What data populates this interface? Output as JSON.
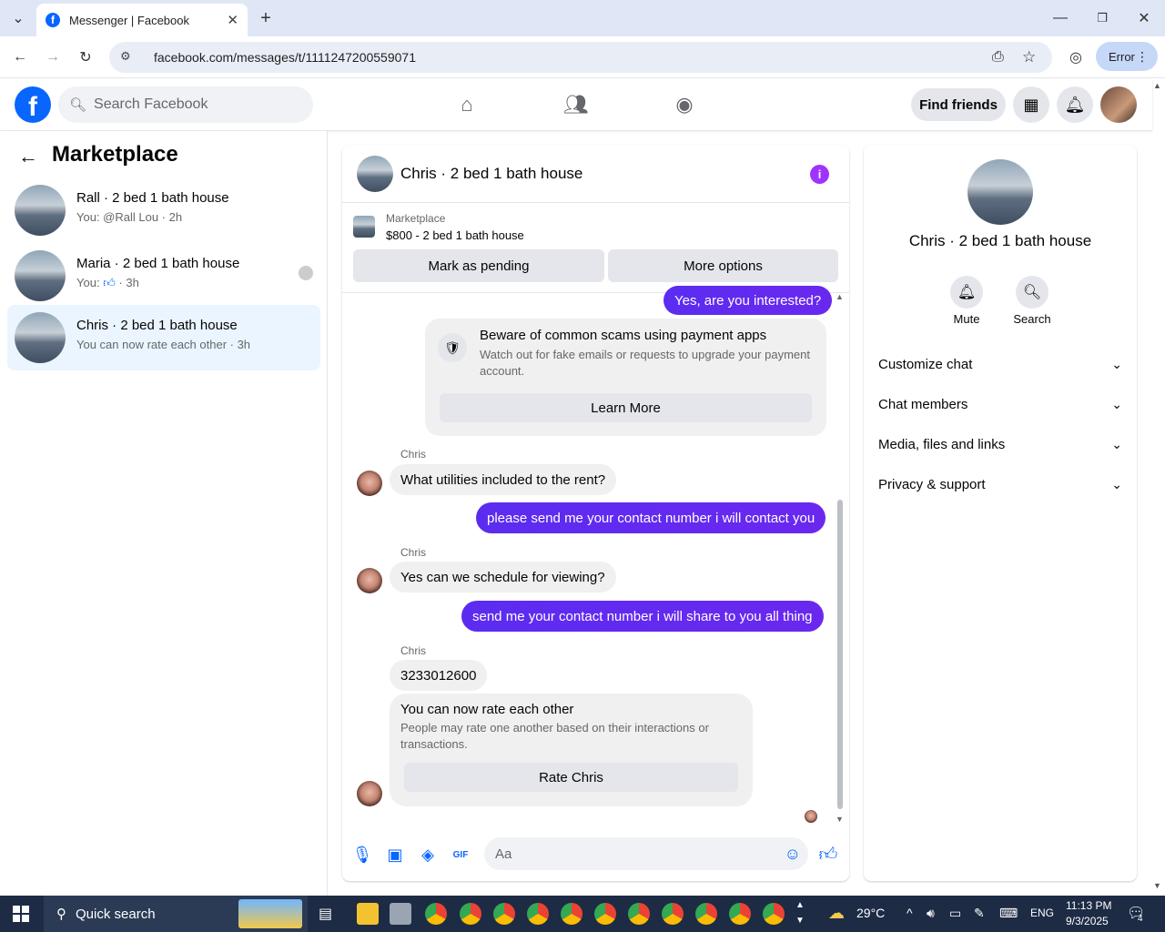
{
  "browser": {
    "tab_title": "Messenger | Facebook",
    "url": "facebook.com/messages/t/1111247200559071",
    "error_label": "Error"
  },
  "fb": {
    "search_placeholder": "Search Facebook",
    "find_friends": "Find friends"
  },
  "left": {
    "title": "Marketplace",
    "conversations": [
      {
        "title": "Rall · 2 bed 1 bath house",
        "preview": "You: @Rall Lou · 2h"
      },
      {
        "title": "Maria · 2 bed 1 bath house",
        "preview_prefix": "You:",
        "preview_suffix": "· 3h"
      },
      {
        "title": "Chris · 2 bed 1 bath house",
        "preview": "You can now rate each other · 3h"
      }
    ]
  },
  "chat": {
    "title": "Chris · 2 bed 1 bath house",
    "listing_source": "Marketplace",
    "listing": "$800 - 2 bed 1 bath house",
    "mark_pending": "Mark as pending",
    "more_options": "More options",
    "msg_top": "Yes, are you interested?",
    "scam_title": "Beware of common scams using payment apps",
    "scam_body": "Watch out for fake emails or requests to upgrade your payment account.",
    "learn_more": "Learn More",
    "sender": "Chris",
    "msg1": "What utilities included to the rent?",
    "msg2": "please send me your contact number i will contact you",
    "msg3": "Yes can we schedule for viewing?",
    "msg4": "send me your contact number i will share to you all thing",
    "msg5": "3233012600",
    "rate_title": "You can now rate each other",
    "rate_body": "People may rate one another based on their interactions or transactions.",
    "rate_button": "Rate Chris",
    "composer_placeholder": "Aa"
  },
  "right": {
    "title": "Chris · 2 bed 1 bath house",
    "mute": "Mute",
    "search": "Search",
    "sections": [
      "Customize chat",
      "Chat members",
      "Media, files and links",
      "Privacy & support"
    ]
  },
  "taskbar": {
    "search": "Quick search",
    "weather": "29°C",
    "lang": "ENG",
    "time": "11:13 PM",
    "date": "9/3/2025",
    "notif_count": "4"
  }
}
